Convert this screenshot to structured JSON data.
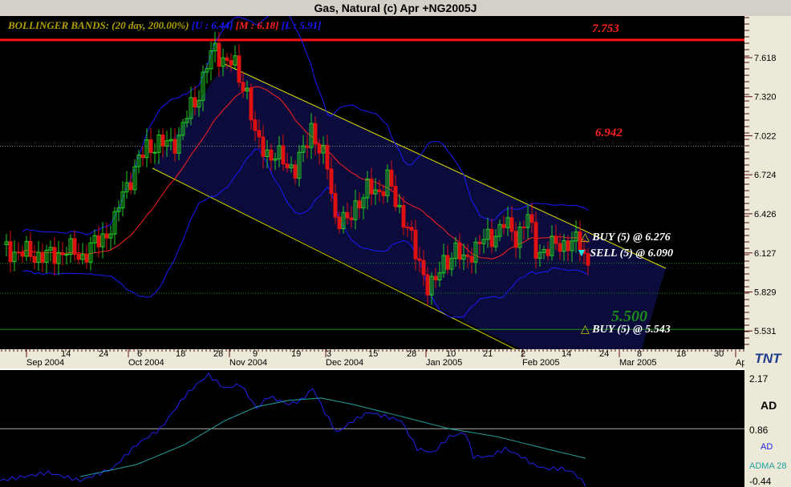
{
  "window": {
    "title": "Gas, Natural (c) Apr +NG2005J"
  },
  "indicator": {
    "label": "BOLLINGER BANDS: (20 day, 200.00%)",
    "upper": "[U : 6.44]",
    "middle": "[M : 6.18]",
    "lower": "[L : 5.91]"
  },
  "annotations": {
    "level1": "7.753",
    "level2": "6.942",
    "level3": "5.500",
    "buy1": "BUY (5) @ 6.276",
    "sell1": "SELL (5) @ 6.090",
    "buy2": "BUY (5) @ 5.543"
  },
  "price_axis": [
    "7.618",
    "7.320",
    "7.022",
    "6.724",
    "6.426",
    "6.127",
    "5.829",
    "5.531"
  ],
  "time_axis": {
    "days": [
      "14",
      "24",
      "6",
      "18",
      "28",
      "9",
      "19",
      "3",
      "15",
      "28",
      "10",
      "21",
      "2",
      "14",
      "24",
      "8",
      "18",
      "30"
    ],
    "months": [
      "Sep 2004",
      "Oct 2004",
      "Nov 2004",
      "Dec 2004",
      "Jan 2005",
      "Feb 2005",
      "Mar 2005",
      "Apr"
    ]
  },
  "logo": "TNT",
  "lower_panel": {
    "title": "AD",
    "top": "2.17",
    "mid": "0.86",
    "bottom": "-0.44",
    "legend_ad": "AD",
    "legend_adma": "ADMA 28"
  },
  "colors": {
    "up": "#22cc22",
    "down": "#dd1111",
    "band": "#1a1aff",
    "mid": "#ff2020",
    "channel": "#e0e000",
    "ad": "#2222ee",
    "adma": "#20a0a0"
  },
  "chart_data": {
    "type": "candlestick",
    "price_range": [
      5.45,
      7.87
    ],
    "close_anchors": [
      [
        1,
        6.15
      ],
      [
        6,
        6.12
      ],
      [
        12,
        6.1
      ],
      [
        16,
        6.15
      ],
      [
        20,
        6.1
      ],
      [
        24,
        6.22
      ],
      [
        28,
        6.35
      ],
      [
        30,
        6.6
      ],
      [
        33,
        6.75
      ],
      [
        36,
        6.95
      ],
      [
        40,
        6.95
      ],
      [
        44,
        7.0
      ],
      [
        47,
        7.25
      ],
      [
        49,
        7.35
      ],
      [
        51,
        7.55
      ],
      [
        53,
        7.7
      ],
      [
        55,
        7.6
      ],
      [
        58,
        7.55
      ],
      [
        61,
        7.35
      ],
      [
        63,
        7.0
      ],
      [
        65,
        6.95
      ],
      [
        67,
        6.85
      ],
      [
        70,
        6.85
      ],
      [
        73,
        6.75
      ],
      [
        75,
        6.9
      ],
      [
        77,
        7.1
      ],
      [
        79,
        6.9
      ],
      [
        81,
        6.8
      ],
      [
        83,
        6.4
      ],
      [
        86,
        6.35
      ],
      [
        88,
        6.5
      ],
      [
        91,
        6.6
      ],
      [
        94,
        6.6
      ],
      [
        96,
        6.7
      ],
      [
        98,
        6.5
      ],
      [
        101,
        6.35
      ],
      [
        103,
        6.1
      ],
      [
        106,
        5.9
      ],
      [
        108,
        5.9
      ],
      [
        110,
        6.05
      ],
      [
        113,
        6.15
      ],
      [
        115,
        6.05
      ],
      [
        117,
        6.15
      ],
      [
        119,
        6.2
      ],
      [
        122,
        6.25
      ],
      [
        125,
        6.35
      ],
      [
        128,
        6.25
      ],
      [
        131,
        6.4
      ],
      [
        133,
        6.15
      ],
      [
        136,
        6.15
      ],
      [
        139,
        6.2
      ],
      [
        142,
        6.2
      ],
      [
        144,
        6.2
      ],
      [
        146,
        6.05
      ]
    ],
    "hlines": [
      {
        "value": 7.753,
        "style": "solid-red"
      },
      {
        "value": 6.942,
        "style": "dotted-gray"
      },
      {
        "value": 6.05,
        "style": "dotted-green"
      },
      {
        "value": 5.82,
        "style": "dotted-green"
      },
      {
        "value": 5.543,
        "style": "solid-green"
      }
    ],
    "ad_range": [
      -0.44,
      2.17
    ],
    "ad_anchors": [
      [
        0,
        -0.44
      ],
      [
        12,
        -0.24
      ],
      [
        20,
        -0.44
      ],
      [
        28,
        -0.14
      ],
      [
        34,
        0.46
      ],
      [
        40,
        0.86
      ],
      [
        46,
        1.67
      ],
      [
        49,
        1.97
      ],
      [
        52,
        2.21
      ],
      [
        56,
        1.87
      ],
      [
        60,
        1.97
      ],
      [
        64,
        1.37
      ],
      [
        67,
        1.67
      ],
      [
        72,
        1.47
      ],
      [
        75,
        1.57
      ],
      [
        78,
        1.87
      ],
      [
        81,
        1.27
      ],
      [
        84,
        0.76
      ],
      [
        88,
        1.06
      ],
      [
        92,
        1.27
      ],
      [
        96,
        1.17
      ],
      [
        100,
        1.06
      ],
      [
        104,
        0.36
      ],
      [
        108,
        0.26
      ],
      [
        112,
        0.66
      ],
      [
        116,
        0.76
      ],
      [
        118,
        0.16
      ],
      [
        122,
        0.16
      ],
      [
        126,
        0.36
      ],
      [
        130,
        0.16
      ],
      [
        133,
        -0.04
      ],
      [
        136,
        -0.14
      ],
      [
        140,
        -0.14
      ],
      [
        143,
        -0.24
      ],
      [
        146,
        -0.54
      ]
    ],
    "adma_anchors": [
      [
        20,
        -0.34
      ],
      [
        34,
        -0.04
      ],
      [
        46,
        0.46
      ],
      [
        56,
        1.06
      ],
      [
        64,
        1.41
      ],
      [
        72,
        1.57
      ],
      [
        80,
        1.63
      ],
      [
        88,
        1.47
      ],
      [
        100,
        1.17
      ],
      [
        112,
        0.86
      ],
      [
        124,
        0.66
      ],
      [
        136,
        0.36
      ],
      [
        146,
        0.12
      ]
    ]
  }
}
